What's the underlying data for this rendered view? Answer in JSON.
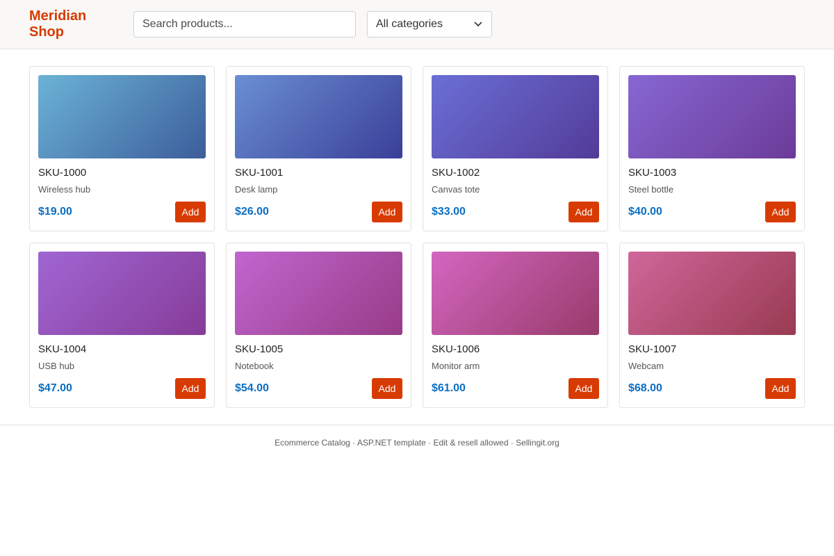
{
  "header": {
    "logo": "Meridian Shop",
    "search_placeholder": "Search products...",
    "category": "All categories"
  },
  "products": [
    {
      "sku": "SKU-1000",
      "name": "Wireless hub",
      "price": "$19.00",
      "add_label": "Add",
      "colors": [
        "#6bb3d6",
        "#3c5d9b"
      ]
    },
    {
      "sku": "SKU-1001",
      "name": "Desk lamp",
      "price": "$26.00",
      "add_label": "Add",
      "colors": [
        "#6a8fd3",
        "#3a3f98"
      ]
    },
    {
      "sku": "SKU-1002",
      "name": "Canvas tote",
      "price": "$33.00",
      "add_label": "Add",
      "colors": [
        "#6b6fd6",
        "#523b98"
      ]
    },
    {
      "sku": "SKU-1003",
      "name": "Steel bottle",
      "price": "$40.00",
      "add_label": "Add",
      "colors": [
        "#8767d3",
        "#6b3b98"
      ]
    },
    {
      "sku": "SKU-1004",
      "name": "USB hub",
      "price": "$47.00",
      "add_label": "Add",
      "colors": [
        "#a166d3",
        "#853b98"
      ]
    },
    {
      "sku": "SKU-1005",
      "name": "Notebook",
      "price": "$54.00",
      "add_label": "Add",
      "colors": [
        "#c066cf",
        "#983b87"
      ]
    },
    {
      "sku": "SKU-1006",
      "name": "Monitor arm",
      "price": "$61.00",
      "add_label": "Add",
      "colors": [
        "#d366c0",
        "#983b6b"
      ]
    },
    {
      "sku": "SKU-1007",
      "name": "Webcam",
      "price": "$68.00",
      "add_label": "Add",
      "colors": [
        "#d0669a",
        "#983b52"
      ]
    }
  ],
  "footer": {
    "text": "Ecommerce Catalog · ASP.NET template · Edit & resell allowed · Sellingit.org"
  }
}
